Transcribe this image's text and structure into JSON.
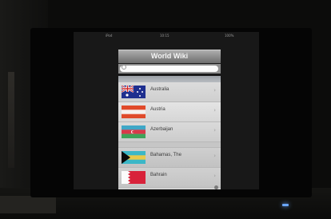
{
  "status_bar": {
    "carrier": "iPod",
    "time": "10:15",
    "battery": "100%"
  },
  "nav": {
    "title": "World Wiki"
  },
  "search": {
    "placeholder": ""
  },
  "countries": [
    {
      "name": "Australia",
      "flag": "australia-flag-icon"
    },
    {
      "name": "Austria",
      "flag": "austria-flag-icon"
    },
    {
      "name": "Azerbaijan",
      "flag": "azerbaijan-flag-icon"
    },
    {
      "name": "Bahamas, The",
      "flag": "bahamas-flag-icon"
    },
    {
      "name": "Bahrain",
      "flag": "bahrain-flag-icon"
    }
  ],
  "colors": {
    "nav_bar": "#8e8e8e",
    "list_background": "#d2d2d2",
    "indicator_led": "#6aa6ff"
  }
}
